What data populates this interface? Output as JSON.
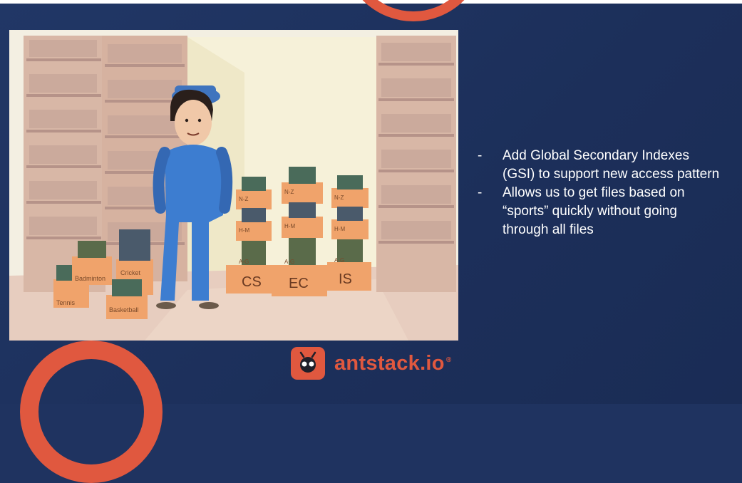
{
  "slide": {
    "bullets": [
      {
        "dash": "-",
        "text": "Add Global Secondary Indexes (GSI) to support new access pattern"
      },
      {
        "dash": "-",
        "text": "Allows us to get files based on “sports” quickly without going through all files"
      }
    ]
  },
  "illustration": {
    "left_boxes": [
      "Tennis",
      "Badminton",
      "Cricket",
      "Basketball"
    ],
    "right_boxes": [
      {
        "label": "CS",
        "tiers": [
          "A-G",
          "H-M",
          "N-Z"
        ]
      },
      {
        "label": "EC",
        "tiers": [
          "A-G",
          "H-M",
          "N-Z"
        ]
      },
      {
        "label": "IS",
        "tiers": [
          "A-G",
          "H-M",
          "N-Z"
        ]
      }
    ]
  },
  "logo": {
    "text": "antstack.io",
    "mark": "®"
  },
  "colors": {
    "background": "#1f3360",
    "accent": "#e0583f",
    "text": "#ffffff"
  }
}
